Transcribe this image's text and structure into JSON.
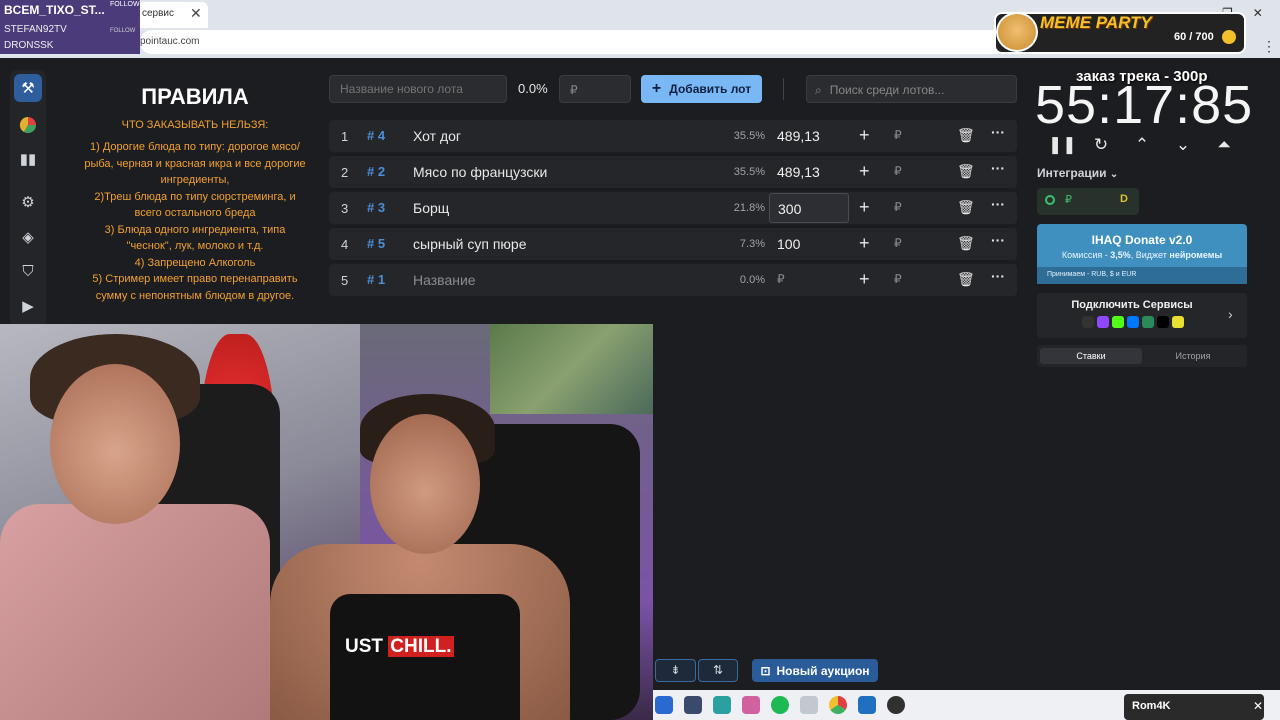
{
  "browser": {
    "tab_title": "сервис",
    "url": "pointauc.com"
  },
  "chat_overlay": {
    "name": "BCEM_TIXO_ST...",
    "follow": "FOLLOW",
    "follow2": "FOLLOW",
    "user1": "STEFAN92TV",
    "user2": "DRONSSK"
  },
  "meme_party": {
    "title": "MEME PARTY",
    "count": "60 / 700"
  },
  "rules": {
    "title": "ПРАВИЛА",
    "subtitle": "ЧТО ЗАКАЗЫВАТЬ НЕЛЬЗЯ:",
    "lines": [
      "1) Дорогие блюда по типу: дорогое мясо/",
      "рыба, черная и красная икра и все дорогие",
      "ингредиенты,",
      "2)Треш блюда по типу сюрстреминга, и",
      "всего остального бреда",
      "3) Блюда одного ингредиента, типа",
      "\"чеснок\", лук, молоко и т.д.",
      "4) Запрещено Алкоголь",
      "5) Стример имеет право перенаправить",
      "сумму с непонятным блюдом в другое."
    ]
  },
  "toolbar": {
    "new_lot_placeholder": "Название нового лота",
    "new_lot_percent": "0.0%",
    "currency": "₽",
    "add_lot_label": "Добавить лот",
    "search_placeholder": "Поиск среди лотов..."
  },
  "lots": [
    {
      "index": "1",
      "id": "# 4",
      "name": "Хот дог",
      "percent": "35.5%",
      "amount": "489,13"
    },
    {
      "index": "2",
      "id": "# 2",
      "name": "Мясо по французски",
      "percent": "35.5%",
      "amount": "489,13"
    },
    {
      "index": "3",
      "id": "# 3",
      "name": "Борщ",
      "percent": "21.8%",
      "amount": "300"
    },
    {
      "index": "4",
      "id": "# 5",
      "name": " сырный суп пюре",
      "percent": "7.3%",
      "amount": "100"
    },
    {
      "index": "5",
      "id": "# 1",
      "name": "Название",
      "percent": "0.0%",
      "amount": "₽"
    }
  ],
  "right_panel": {
    "track_order": "заказ трека - 300р",
    "timer": "55:17:85",
    "integrations": "Интеграции",
    "donate_title": "IHAQ Donate v2.0",
    "donate_sub_prefix": "Комиссия - ",
    "donate_sub_rate": "3,5%",
    "donate_sub_mid": ", Виджет ",
    "donate_sub_brand": "нейромемы",
    "donate_footer": "Принимаем - RUB, $ и EUR",
    "services_title": "Подключить Сервисы",
    "tab_bids": "Ставки",
    "tab_history": "История"
  },
  "bottom": {
    "new_auction_label": "Новый аукцион"
  },
  "webcam": {
    "shirt_text_a": "UST ",
    "shirt_text_b": "CHILL."
  },
  "notification": {
    "text": "Rom4K"
  }
}
